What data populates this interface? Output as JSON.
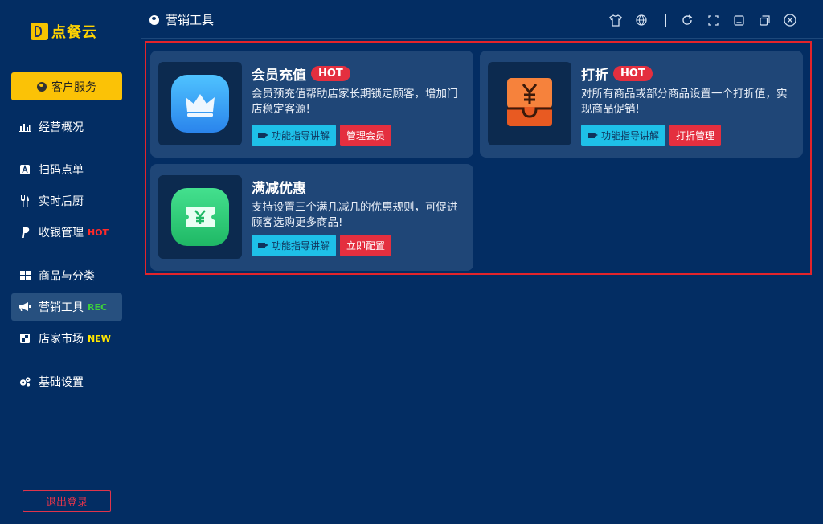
{
  "app": {
    "logo_text": "点餐云"
  },
  "sidebar": {
    "customer_service": "客户服务",
    "items": [
      {
        "label": "经营概况",
        "badge": ""
      },
      {
        "label": "扫码点单",
        "badge": ""
      },
      {
        "label": "实时后厨",
        "badge": ""
      },
      {
        "label": "收银管理",
        "badge": "HOT"
      },
      {
        "label": "商品与分类",
        "badge": ""
      },
      {
        "label": "营销工具",
        "badge": "REC"
      },
      {
        "label": "店家市场",
        "badge": "NEW"
      },
      {
        "label": "基础设置",
        "badge": ""
      }
    ],
    "logout": "退出登录"
  },
  "header": {
    "title": "营销工具"
  },
  "cards": [
    {
      "title": "会员充值",
      "badge": "HOT",
      "desc": "会员预充值帮助店家长期锁定顾客，增加门店稳定客源!",
      "guide_label": "功能指导讲解",
      "action_label": "管理会员",
      "icon": "crown-icon",
      "icon_color": "#3aa6f7"
    },
    {
      "title": "打折",
      "badge": "HOT",
      "desc": "对所有商品或部分商品设置一个打折值，实现商品促销!",
      "guide_label": "功能指导讲解",
      "action_label": "打折管理",
      "icon": "yen-discount-icon",
      "icon_color": "#f26b2b"
    },
    {
      "title": "满减优惠",
      "badge": "",
      "desc": "支持设置三个满几减几的优惠规则，可促进顾客选购更多商品!",
      "guide_label": "功能指导讲解",
      "action_label": "立即配置",
      "icon": "yen-ticket-icon",
      "icon_color": "#2fcf7a"
    }
  ],
  "colors": {
    "background": "#032d63",
    "accent_yellow": "#fbc206",
    "hot_red": "#e42f3f",
    "guide_cyan": "#1ec0e8"
  }
}
